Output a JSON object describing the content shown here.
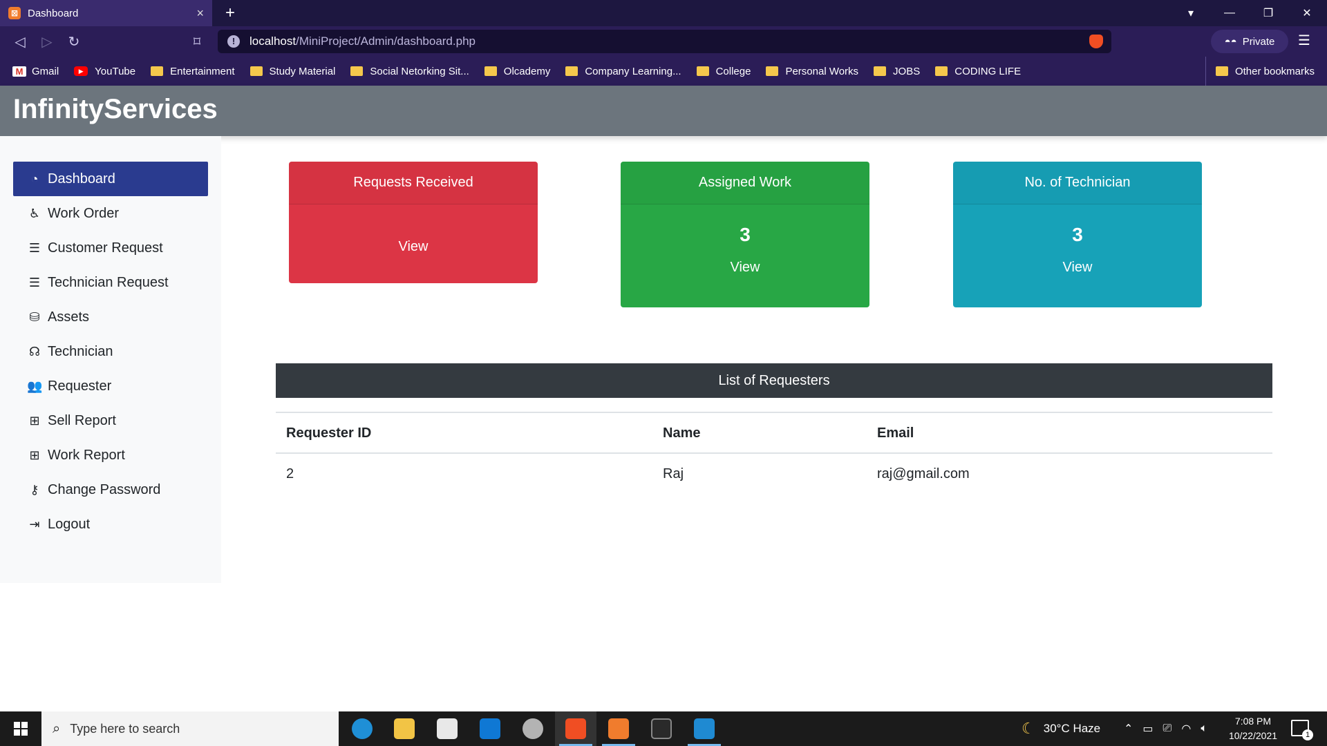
{
  "browser": {
    "tab_title": "Dashboard",
    "tab_close": "×",
    "new_tab": "+",
    "url_host": "localhost",
    "url_path": "/MiniProject/Admin/dashboard.php",
    "private_label": "Private",
    "bookmarks": [
      {
        "label": "Gmail",
        "icon": "gmail-icon"
      },
      {
        "label": "YouTube",
        "icon": "youtube-icon"
      },
      {
        "label": "Entertainment",
        "icon": "folder-icon"
      },
      {
        "label": "Study Material",
        "icon": "folder-icon"
      },
      {
        "label": "Social Netorking Sit...",
        "icon": "folder-icon"
      },
      {
        "label": "Olcademy",
        "icon": "folder-icon"
      },
      {
        "label": "Company Learning...",
        "icon": "folder-icon"
      },
      {
        "label": "College",
        "icon": "folder-icon"
      },
      {
        "label": "Personal Works",
        "icon": "folder-icon"
      },
      {
        "label": "JOBS",
        "icon": "folder-icon"
      },
      {
        "label": "CODING LIFE",
        "icon": "folder-icon"
      }
    ],
    "other_bookmarks": "Other bookmarks"
  },
  "app": {
    "brand": "InfinityServices"
  },
  "sidebar": {
    "items": [
      {
        "label": "Dashboard",
        "icon": "tachometer-icon",
        "active": true
      },
      {
        "label": "Work Order",
        "icon": "accessibility-icon"
      },
      {
        "label": "Customer Request",
        "icon": "align-icon"
      },
      {
        "label": "Technician Request",
        "icon": "align-icon"
      },
      {
        "label": "Assets",
        "icon": "database-icon"
      },
      {
        "label": "Technician",
        "icon": "headset-icon"
      },
      {
        "label": "Requester",
        "icon": "users-icon"
      },
      {
        "label": "Sell Report",
        "icon": "table-icon"
      },
      {
        "label": "Work Report",
        "icon": "table-icon"
      },
      {
        "label": "Change Password",
        "icon": "key-icon"
      },
      {
        "label": "Logout",
        "icon": "sign-out-icon"
      }
    ]
  },
  "cards": [
    {
      "title": "Requests Received",
      "value": "",
      "link": "View",
      "color": "#dc3545"
    },
    {
      "title": "Assigned Work",
      "value": "3",
      "link": "View",
      "color": "#28a745"
    },
    {
      "title": "No. of Technician",
      "value": "3",
      "link": "View",
      "color": "#17a2b8"
    }
  ],
  "requesters": {
    "heading": "List of Requesters",
    "columns": [
      "Requester ID",
      "Name",
      "Email"
    ],
    "rows": [
      [
        "2",
        "Raj",
        "raj@gmail.com"
      ]
    ]
  },
  "taskbar": {
    "search_placeholder": "Type here to search",
    "weather": "30°C  Haze",
    "time": "7:08 PM",
    "date": "10/22/2021",
    "notification_count": "1"
  }
}
